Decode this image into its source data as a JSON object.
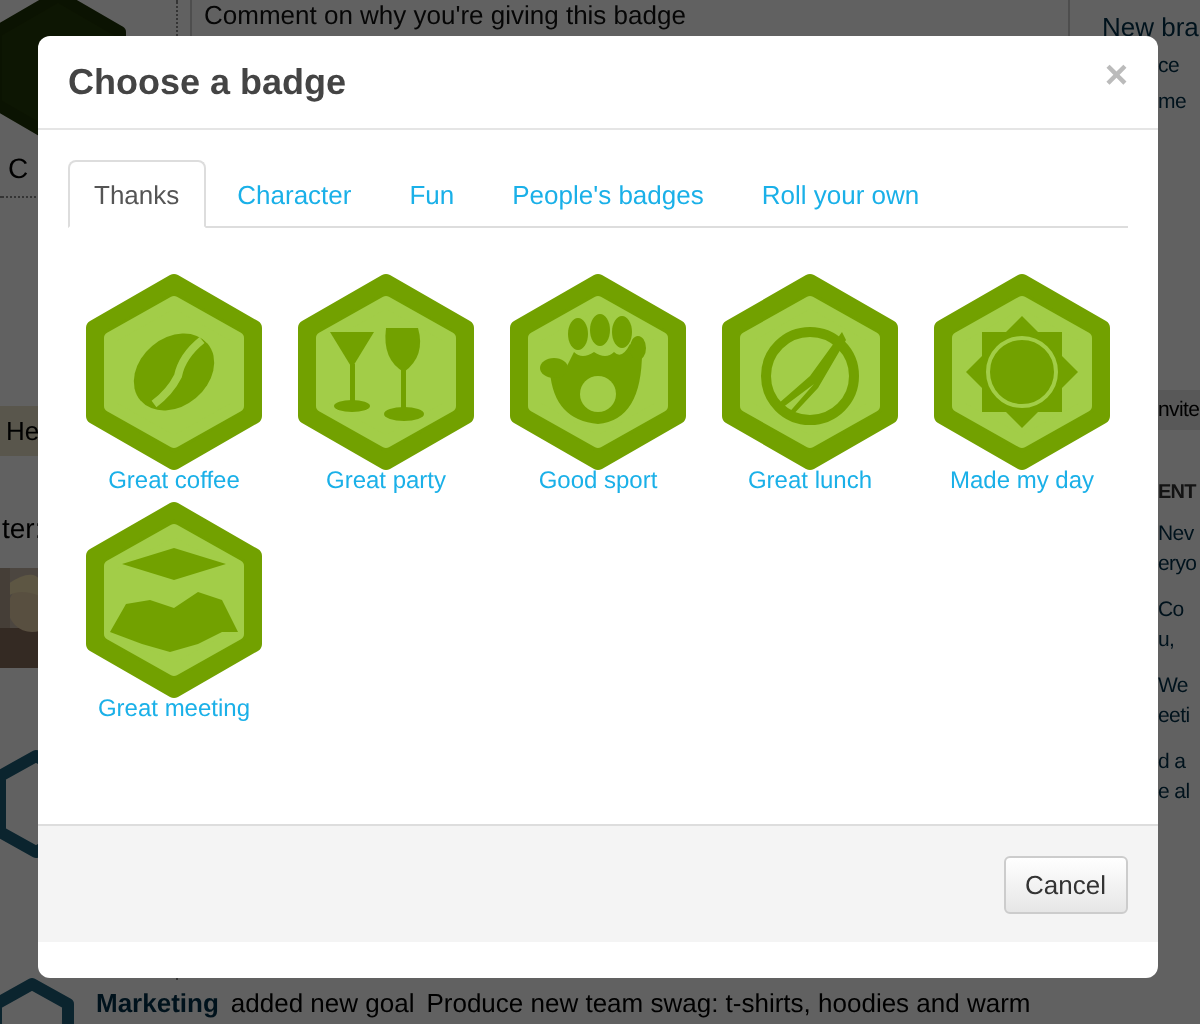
{
  "background": {
    "left": {
      "caption": "C",
      "section_header": "He",
      "label": "ter:"
    },
    "comment_field": {
      "placeholder": "Comment on why you're giving this badge"
    },
    "right_links": [
      "New bra",
      "ce",
      "me"
    ],
    "right_header": "nvite",
    "right_section_title": "ENT",
    "right_items": [
      "Nev",
      "eryo",
      "Co",
      "u,",
      "We",
      "eeti",
      "d a",
      "e al"
    ],
    "feed": {
      "team": "Marketing",
      "action": "added new goal",
      "goal": "Produce new team swag: t-shirts, hoodies and warm"
    }
  },
  "modal": {
    "title": "Choose a badge",
    "close": "×",
    "tabs": [
      {
        "label": "Thanks",
        "selected": true
      },
      {
        "label": "Character",
        "selected": false
      },
      {
        "label": "Fun",
        "selected": false
      },
      {
        "label": "People's badges",
        "selected": false
      },
      {
        "label": "Roll your own",
        "selected": false
      }
    ],
    "badges": [
      {
        "label": "Great coffee"
      },
      {
        "label": "Great party"
      },
      {
        "label": "Good sport"
      },
      {
        "label": "Great lunch"
      },
      {
        "label": "Made my day"
      },
      {
        "label": "Great meeting"
      }
    ],
    "buttons": [
      "Cancel"
    ]
  }
}
